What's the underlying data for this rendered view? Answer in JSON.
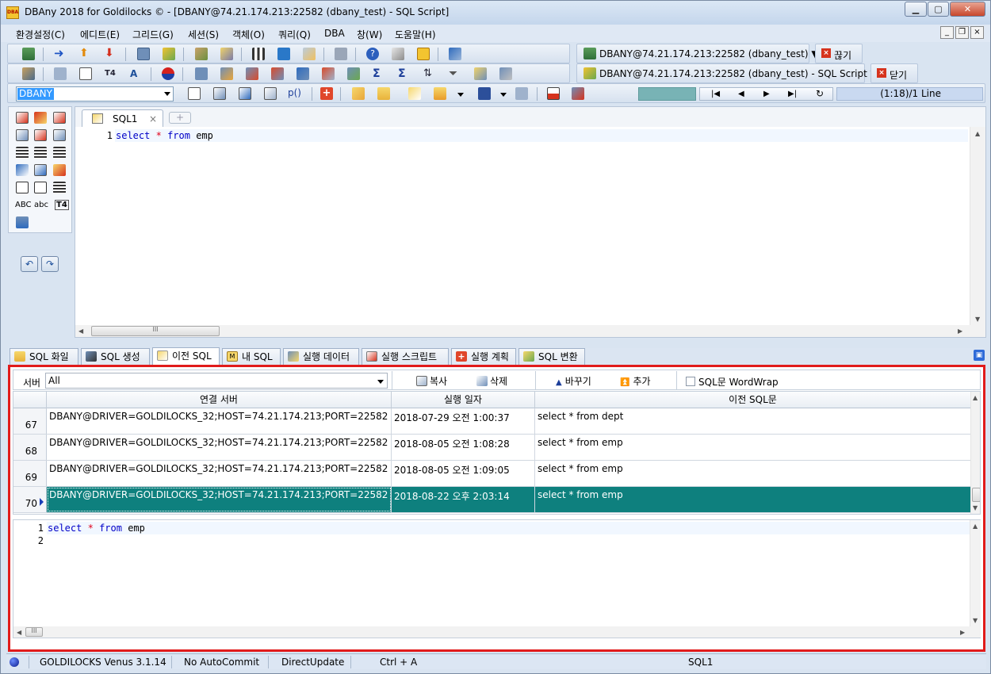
{
  "window": {
    "title": "DBAny 2018 for Goldilocks © - [DBANY@74.21.174.213:22582 (dbany_test) - SQL Script]",
    "icon_text": "DBA"
  },
  "menu": [
    "환경설정(C)",
    "에디트(E)",
    "그리드(G)",
    "세션(S)",
    "객체(O)",
    "쿼리(Q)",
    "DBA",
    "창(W)",
    "도움말(H)"
  ],
  "toolbar": {
    "connection_1": "DBANY@74.21.174.213:22582 (dbany_test) ▼",
    "disconnect_label": "끊기",
    "connection_2": "DBANY@74.21.174.213:22582 (dbany_test) - SQL Script ▼",
    "close_label": "닫기",
    "db_combo_value": "DBANY",
    "p_label": "p()",
    "line_status": "(1:18)/1 Line"
  },
  "left_panel": {
    "abc_upper": "ABC",
    "abc_lower": "abc",
    "t4_label": "T4"
  },
  "editor": {
    "tab_label": "SQL1",
    "tab_close": "×",
    "line_number": "1",
    "code": {
      "kw1": "select",
      "star": "*",
      "kw2": "from",
      "rest": "emp"
    },
    "hscroll_grip": "III"
  },
  "bottom_tabs": [
    "SQL 화일",
    "SQL 생성",
    "이전 SQL",
    "내 SQL",
    "실행 데이터",
    "실행 스크립트",
    "실행 계획",
    "SQL 변환"
  ],
  "history": {
    "server_label": "서버",
    "server_value": "All",
    "buttons": {
      "copy": "복사",
      "delete": "삭제",
      "replace": "바꾸기",
      "add": "추가"
    },
    "wordwrap_label": "SQL문 WordWrap",
    "columns": [
      "연결 서버",
      "실행 일자",
      "이전 SQL문"
    ],
    "rows": [
      {
        "num": "67",
        "server": "DBANY@DRIVER=GOLDILOCKS_32;HOST=74.21.174.213;PORT=22582",
        "date": "2018-07-29 오전 1:00:37",
        "sql": "select * from dept"
      },
      {
        "num": "68",
        "server": "DBANY@DRIVER=GOLDILOCKS_32;HOST=74.21.174.213;PORT=22582",
        "date": "2018-08-05 오전 1:08:28",
        "sql": "select * from emp"
      },
      {
        "num": "69",
        "server": "DBANY@DRIVER=GOLDILOCKS_32;HOST=74.21.174.213;PORT=22582",
        "date": "2018-08-05 오전 1:09:05",
        "sql": "select * from emp"
      },
      {
        "num": "70",
        "server": "DBANY@DRIVER=GOLDILOCKS_32;HOST=74.21.174.213;PORT=22582",
        "date": "2018-08-22 오후 2:03:14",
        "sql": "select * from emp"
      }
    ],
    "preview_lines": [
      "1",
      "2"
    ]
  },
  "status": {
    "db": "GOLDILOCKS Venus 3.1.14",
    "autocommit": "No AutoCommit",
    "update": "DirectUpdate",
    "shortcut": "Ctrl + A",
    "script": "SQL1"
  },
  "colors": {
    "selected_row": "#0e807e",
    "highlight_border": "#e11b1b",
    "keyword": "#0000c8",
    "operator": "#e0001b"
  }
}
